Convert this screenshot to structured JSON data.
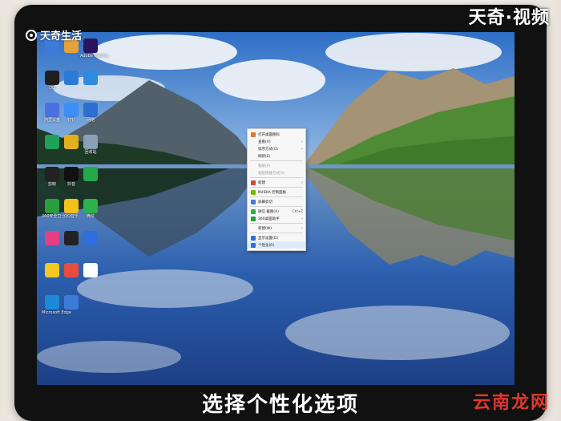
{
  "overlay": {
    "top_left_brand": "天奇生活",
    "top_right_brand": "天奇·视频",
    "subtitle": "选择个性化选项",
    "watermark": "云南龙网"
  },
  "desktop_icons": [
    {
      "label": "",
      "color": "#3c7bd8"
    },
    {
      "label": "",
      "color": "#e4a23a"
    },
    {
      "label": "Adobe Premie..",
      "color": "#2a1660"
    },
    {
      "label": "QQ",
      "color": "#1f1f1f"
    },
    {
      "label": "",
      "color": "#2d79d6"
    },
    {
      "label": "",
      "color": "#2f8be0"
    },
    {
      "label": "阿里云盘",
      "color": "#4e6fe0"
    },
    {
      "label": "钉钉",
      "color": "#3d8ff5"
    },
    {
      "label": "网络",
      "color": "#2d6fd0"
    },
    {
      "label": "",
      "color": "#1fa15a"
    },
    {
      "label": "",
      "color": "#e0b020"
    },
    {
      "label": "回收站",
      "color": "#8aa0b8"
    },
    {
      "label": "剪映",
      "color": "#222222"
    },
    {
      "label": "抖音",
      "color": "#111111"
    },
    {
      "label": "",
      "color": "#23a84a"
    },
    {
      "label": "360安全卫士",
      "color": "#2a9d3d"
    },
    {
      "label": "QQ音乐",
      "color": "#f2c21b"
    },
    {
      "label": "微信",
      "color": "#2bb24c"
    },
    {
      "label": "",
      "color": "#e33f83"
    },
    {
      "label": "",
      "color": "#222222"
    },
    {
      "label": "",
      "color": "#2b6fe0"
    },
    {
      "label": "",
      "color": "#f3c724"
    },
    {
      "label": "",
      "color": "#e84c3d"
    },
    {
      "label": "",
      "color": "#ffffff"
    },
    {
      "label": "Microsoft Edge",
      "color": "#1b8ad8"
    },
    {
      "label": "",
      "color": "#3c7bd8"
    }
  ],
  "context_menu": {
    "items": [
      {
        "type": "item",
        "label": "打开桌面图标",
        "icon_color": "#e07a2a",
        "arrow": false,
        "shortcut": "",
        "disabled": false
      },
      {
        "type": "item",
        "label": "查看(V)",
        "icon_color": "",
        "arrow": true,
        "shortcut": "",
        "disabled": false
      },
      {
        "type": "item",
        "label": "排序方式(O)",
        "icon_color": "",
        "arrow": true,
        "shortcut": "",
        "disabled": false
      },
      {
        "type": "item",
        "label": "刷新(E)",
        "icon_color": "",
        "arrow": false,
        "shortcut": "",
        "disabled": false
      },
      {
        "type": "sep"
      },
      {
        "type": "item",
        "label": "粘贴(P)",
        "icon_color": "",
        "arrow": false,
        "shortcut": "",
        "disabled": true
      },
      {
        "type": "item",
        "label": "粘贴快捷方式(S)",
        "icon_color": "",
        "arrow": false,
        "shortcut": "",
        "disabled": true
      },
      {
        "type": "sep"
      },
      {
        "type": "item",
        "label": "新建",
        "icon_color": "#d24b3a",
        "arrow": true,
        "shortcut": "",
        "disabled": false
      },
      {
        "type": "sep"
      },
      {
        "type": "item",
        "label": "NVIDIA 控制面板",
        "icon_color": "#76b900",
        "arrow": false,
        "shortcut": "",
        "disabled": false
      },
      {
        "type": "sep"
      },
      {
        "type": "item",
        "label": "屏幕剪切",
        "icon_color": "#3a7de0",
        "arrow": false,
        "shortcut": "",
        "disabled": false
      },
      {
        "type": "sep"
      },
      {
        "type": "item",
        "label": "微信 截图(A)",
        "icon_color": "#2bb24c",
        "arrow": false,
        "shortcut": "Ctrl+Z",
        "disabled": false
      },
      {
        "type": "item",
        "label": "360桌面助手",
        "icon_color": "#2a9d3d",
        "arrow": true,
        "shortcut": "",
        "disabled": false
      },
      {
        "type": "sep"
      },
      {
        "type": "item",
        "label": "新建(W)",
        "icon_color": "",
        "arrow": true,
        "shortcut": "",
        "disabled": false
      },
      {
        "type": "sep"
      },
      {
        "type": "item",
        "label": "显示设置(D)",
        "icon_color": "#2f6fd6",
        "arrow": false,
        "shortcut": "",
        "disabled": false
      },
      {
        "type": "item",
        "label": "个性化(R)",
        "icon_color": "#2f6fd6",
        "arrow": false,
        "shortcut": "",
        "disabled": false,
        "highlighted": true
      }
    ]
  }
}
